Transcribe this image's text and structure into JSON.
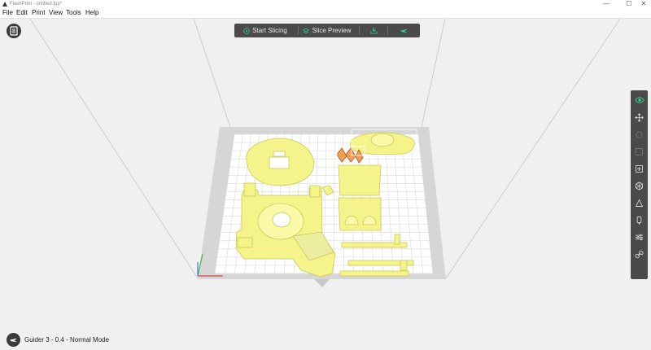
{
  "window": {
    "title": "FlashPrint - untitled.fpp*",
    "minimize": "—",
    "maximize": "☐",
    "close": "✕"
  },
  "menu": [
    "File",
    "Edit",
    "Print",
    "View",
    "Tools",
    "Help"
  ],
  "toolbar": {
    "start_slicing": "Start Slicing",
    "slice_preview": "Slice Preview"
  },
  "right_panel": {
    "tools": [
      "view-icon",
      "move-icon",
      "rotate-icon",
      "scale-icon",
      "cut-icon",
      "support-icon",
      "measure-icon",
      "extruder-icon",
      "settings-icon",
      "link-icon"
    ],
    "active": "view-icon"
  },
  "status": {
    "printer": "Guider 3 - 0.4 - Normal Mode"
  },
  "colors": {
    "model": "#f4f48a",
    "model_edge": "#c9c95a",
    "platform": "#d6d6d6",
    "grid_bg": "#ffffff",
    "panel": "#4a4a4a",
    "accent_active": "#32c88c",
    "icon_light": "#e8e8e8"
  }
}
